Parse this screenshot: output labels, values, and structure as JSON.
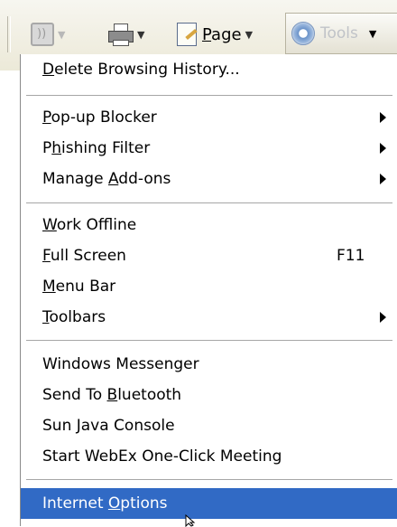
{
  "toolbar": {
    "page_label": "Page",
    "page_accel": "P",
    "tools_label": "Tools",
    "icons": [
      "feeds-icon",
      "print-icon",
      "page-icon",
      "tools-gear-icon"
    ]
  },
  "menu": {
    "items": [
      {
        "label": "Delete Browsing History...",
        "accel": "D",
        "shortcut": "",
        "submenu": false
      },
      {
        "label": "Pop-up Blocker",
        "accel": "P",
        "shortcut": "",
        "submenu": true
      },
      {
        "label": "Phishing Filter",
        "accel": "h",
        "shortcut": "",
        "submenu": true
      },
      {
        "label": "Manage Add-ons",
        "accel": "A",
        "shortcut": "",
        "submenu": true
      },
      {
        "label": "Work Offline",
        "accel": "W",
        "shortcut": "",
        "submenu": false
      },
      {
        "label": "Full Screen",
        "accel": "F",
        "shortcut": "F11",
        "submenu": false
      },
      {
        "label": "Menu Bar",
        "accel": "M",
        "shortcut": "",
        "submenu": false
      },
      {
        "label": "Toolbars",
        "accel": "T",
        "shortcut": "",
        "submenu": true
      },
      {
        "label": "Windows Messenger",
        "accel": "",
        "shortcut": "",
        "submenu": false
      },
      {
        "label": "Send To Bluetooth",
        "accel": "B",
        "shortcut": "",
        "submenu": false
      },
      {
        "label": "Sun Java Console",
        "accel": "",
        "shortcut": "",
        "submenu": false
      },
      {
        "label": "Start WebEx One-Click Meeting",
        "accel": "",
        "shortcut": "",
        "submenu": false
      },
      {
        "label": "Internet Options",
        "accel": "O",
        "shortcut": "",
        "submenu": false,
        "highlighted": true
      }
    ]
  },
  "colors": {
    "highlight": "#316ac5",
    "toolbar_bg": "#ece9d8"
  }
}
